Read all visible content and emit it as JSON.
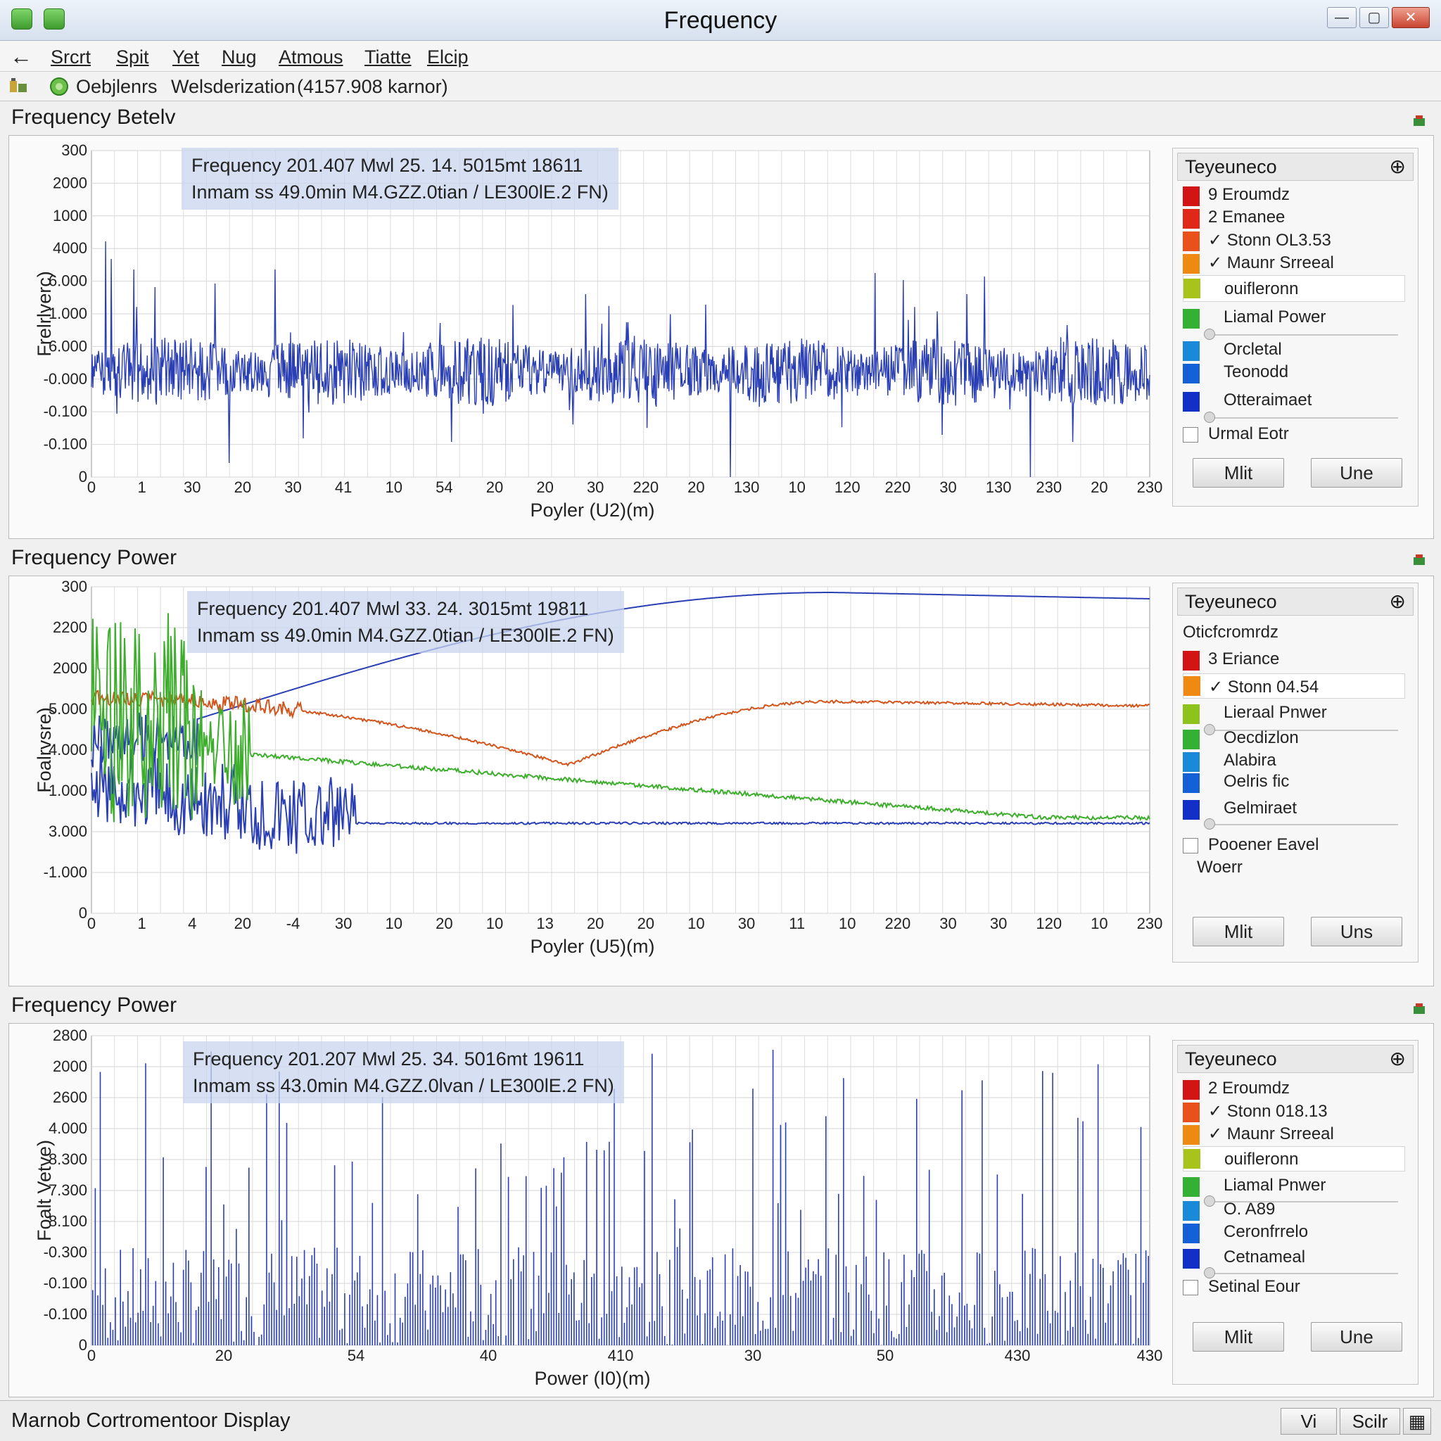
{
  "window": {
    "title": "Frequency",
    "minimize_label": "—",
    "maximize_label": "▢",
    "close_label": "✕"
  },
  "menu": {
    "back_label": "←",
    "items": [
      "Srcrt",
      "Spit",
      "Yet",
      "Nug",
      "Atmous",
      "Tiatte",
      "Elcip"
    ]
  },
  "toolbar": {
    "label1": "Oebjlenrs",
    "label2": "Welsderization",
    "label3": "(4157.908 karnor)"
  },
  "panels": [
    {
      "title": "Frequency Betelv",
      "info_line1": "Frequency 201.407  Mwl 25. 14. 5015mt  18611",
      "info_line2": "Inmam ss 49.0min  M4.GZZ.0tian / LE300lE.2 FN)",
      "ylabel": "Frelrlverc)",
      "xlabel": "Poyler (U2)(m)",
      "yticks": [
        "300",
        "2000",
        "1000",
        "4000",
        "6.000",
        "1.000",
        "6.000",
        "-0.000",
        "-0.100",
        "-0.100",
        "0"
      ],
      "xticks": [
        "0",
        "1",
        "30",
        "20",
        "30",
        "41",
        "10",
        "54",
        "20",
        "20",
        "30",
        "220",
        "20",
        "130",
        "10",
        "120",
        "220",
        "30",
        "130",
        "230",
        "20",
        "230"
      ],
      "legend": {
        "head": "Teyeuneco",
        "items": [
          {
            "label": "9 Eroumdz",
            "color": "#d21414"
          },
          {
            "label": "2 Emanee",
            "color": "#e02818"
          },
          {
            "label": "✓ Stonn OL3.53",
            "color": "#e8521a"
          },
          {
            "label": "✓ Maunr Srreeal",
            "color": "#ee8a12"
          },
          {
            "label": "ouifleronn",
            "color": "#a8c41c"
          },
          {
            "label": "Liamal Power",
            "color": "#34b034"
          },
          {
            "label": "Orcletal",
            "color": "#1a8ad8"
          },
          {
            "label": "Teonodd",
            "color": "#1460d6"
          },
          {
            "label": "Otteraimaet",
            "color": "#1030c8"
          },
          {
            "label": "Urmal Eotr",
            "color": ""
          }
        ],
        "button1": "Mlit",
        "button2": "Une"
      },
      "chart_data": {
        "type": "line",
        "series": [
          {
            "color": "#2b3fb5"
          }
        ],
        "note_style": "noisy signal"
      }
    },
    {
      "title": "Frequency Power",
      "info_line1": "Frequency 201.407  Mwl 33. 24. 3015mt  19811",
      "info_line2": "Inmam ss 49.0min  M4.GZZ.0tian / LE300lE.2 FN)",
      "ylabel": "Foalrvsre)",
      "xlabel": "Poyler (U5)(m)",
      "yticks": [
        "300",
        "2200",
        "2000",
        "5.000",
        "4.000",
        "1.000",
        "3.000",
        "-1.000",
        "0"
      ],
      "xticks": [
        "0",
        "1",
        "4",
        "20",
        "-4",
        "30",
        "10",
        "20",
        "10",
        "13",
        "20",
        "20",
        "10",
        "30",
        "11",
        "10",
        "220",
        "30",
        "30",
        "120",
        "10",
        "230"
      ],
      "legend": {
        "head": "Teyeuneco",
        "subhead": "Oticfcromrdz",
        "items": [
          {
            "label": "3 Eriance",
            "color": "#d21414"
          },
          {
            "label": "✓ Stonn 04.54",
            "color": "#ee8a12"
          },
          {
            "label": "Lieraal Pnwer",
            "color": "#8ec21c"
          },
          {
            "label": "Oecdizlon",
            "color": "#34b034"
          },
          {
            "label": "Alabira",
            "color": "#1a8ad8"
          },
          {
            "label": "Oelris fic",
            "color": "#1460d6"
          },
          {
            "label": "Gelmiraet",
            "color": "#1030c8"
          },
          {
            "label": "Pooener Eavel",
            "color": ""
          },
          {
            "label": "Woerr",
            "color": ""
          }
        ],
        "button1": "Mlit",
        "button2": "Uns"
      },
      "chart_data": {
        "type": "line",
        "series": [
          {
            "color": "#2b3fb5"
          },
          {
            "color": "#d2551e"
          },
          {
            "color": "#3cae2c"
          }
        ]
      }
    },
    {
      "title": "Frequency Power",
      "info_line1": "Frequency 201.207  Mwl 25. 34. 5016mt  19611",
      "info_line2": "Inmam ss 43.0min  M4.GZZ.0lvan / LE300lE.2 FN)",
      "ylabel": "Foalt Vetve)",
      "xlabel": "Power (I0)(m)",
      "yticks": [
        "2800",
        "2000",
        "2600",
        "4.000",
        "8.300",
        "7.300",
        "8.100",
        "-0.300",
        "-0.100",
        "-0.100",
        "0"
      ],
      "xticks": [
        "0",
        "20",
        "54",
        "40",
        "410",
        "30",
        "50",
        "430",
        "430"
      ],
      "legend": {
        "head": "Teyeuneco",
        "items": [
          {
            "label": "2 Eroumdz",
            "color": "#d21414"
          },
          {
            "label": "✓ Stonn 018.13",
            "color": "#e8521a"
          },
          {
            "label": "✓ Maunr Srreeal",
            "color": "#ee8a12"
          },
          {
            "label": "ouifleronn",
            "color": "#a8c41c"
          },
          {
            "label": "Liamal Pnwer",
            "color": "#34b034"
          },
          {
            "label": "O. A89",
            "color": "#1a8ad8"
          },
          {
            "label": "Ceronfrrelo",
            "color": "#1460d6"
          },
          {
            "label": "Cetnameal",
            "color": "#1030c8"
          },
          {
            "label": "Setinal Eour",
            "color": ""
          }
        ],
        "button1": "Mlit",
        "button2": "Une"
      },
      "chart_data": {
        "type": "bar",
        "series": [
          {
            "color": "#2b3fb5"
          }
        ]
      }
    }
  ],
  "status": {
    "text": "Marnob Cortromentoor Display",
    "btn1": "Vi",
    "btn2": "Scilr"
  }
}
